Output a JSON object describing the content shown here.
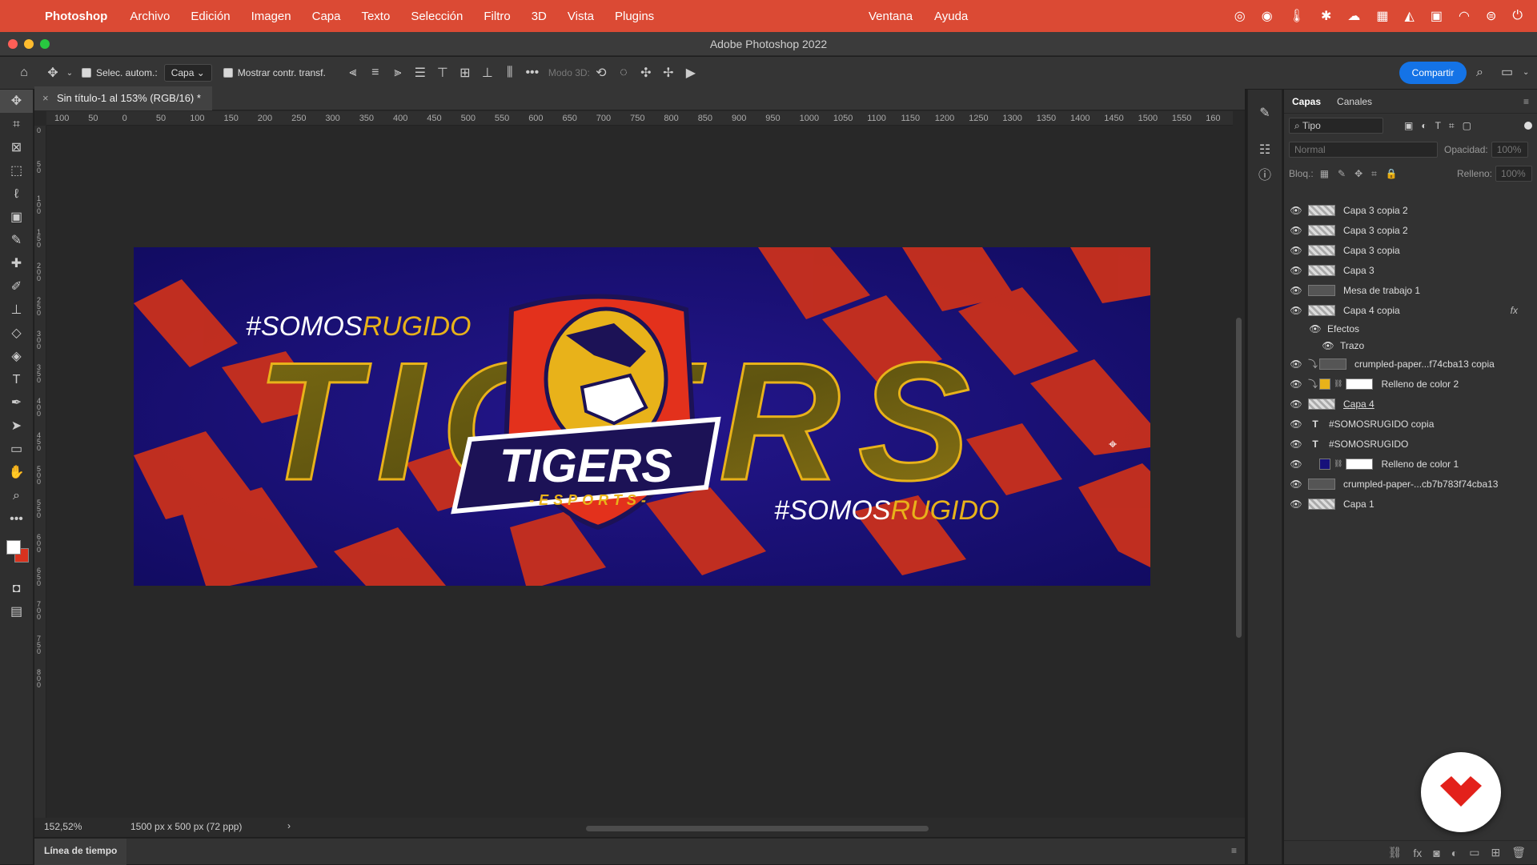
{
  "menubar": {
    "app": "Photoshop",
    "items": [
      "Archivo",
      "Edición",
      "Imagen",
      "Capa",
      "Texto",
      "Selección",
      "Filtro",
      "3D",
      "Vista",
      "Plugins"
    ],
    "ventana": "Ventana",
    "ayuda": "Ayuda"
  },
  "window": {
    "title": "Adobe Photoshop 2022"
  },
  "options": {
    "auto_select": "Selec. autom.:",
    "auto_select_target": "Capa",
    "show_transform": "Mostrar contr. transf.",
    "mode3d": "Modo 3D:",
    "share": "Compartir"
  },
  "document": {
    "tab": "Sin título-1 al 153% (RGB/16) *",
    "zoom": "152,52%",
    "info": "1500 px x 500 px (72 ppp)"
  },
  "ruler": {
    "h": [
      "100",
      "50",
      "0",
      "50",
      "100",
      "150",
      "200",
      "250",
      "300",
      "350",
      "400",
      "450",
      "500",
      "550",
      "600",
      "650",
      "700",
      "750",
      "800",
      "850",
      "900",
      "950",
      "1000",
      "1050",
      "1100",
      "1150",
      "1200",
      "1250",
      "1300",
      "1350",
      "1400",
      "1450",
      "1500",
      "1550",
      "160"
    ],
    "v": [
      "0",
      "50",
      "100",
      "150",
      "200",
      "250",
      "300",
      "350",
      "400",
      "450",
      "500",
      "550",
      "600",
      "650",
      "700",
      "750",
      "800"
    ]
  },
  "artwork": {
    "hashtag_prefix": "#SOMOS",
    "hashtag_suffix": "RUGIDO",
    "big_word": "TIGERS",
    "logo_word": "TIGERS",
    "logo_sub": "-ESPORTS-"
  },
  "timeline": {
    "label": "Línea de tiempo"
  },
  "panel": {
    "tabs": [
      "Capas",
      "Canales"
    ],
    "filter": "Tipo",
    "blend": "Normal",
    "opacity_label": "Opacidad:",
    "opacity": "100%",
    "lock_label": "Bloq.:",
    "fill_label": "Relleno:",
    "fill": "100%"
  },
  "layers": [
    {
      "name": "Capa 3 copia 2",
      "kind": "pixel"
    },
    {
      "name": "Capa 3 copia 2",
      "kind": "pixel"
    },
    {
      "name": "Capa 3 copia",
      "kind": "pixel"
    },
    {
      "name": "Capa 3",
      "kind": "pixel"
    },
    {
      "name": "Mesa de trabajo 1",
      "kind": "smart"
    },
    {
      "name": "Capa 4 copia",
      "kind": "pixel",
      "fx": "fx"
    },
    {
      "name": "Efectos",
      "kind": "effect"
    },
    {
      "name": "Trazo",
      "kind": "effect2"
    },
    {
      "name": "crumpled-paper...f74cba13 copia",
      "kind": "smart-clip"
    },
    {
      "name": "Relleno de color 2",
      "kind": "fill-yellow"
    },
    {
      "name": "Capa 4",
      "kind": "pixel"
    },
    {
      "name": "#SOMOSRUGIDO copia",
      "kind": "text"
    },
    {
      "name": "#SOMOSRUGIDO",
      "kind": "text"
    },
    {
      "name": "Relleno de color 1",
      "kind": "fill-navy"
    },
    {
      "name": "crumpled-paper-...cb7b783f74cba13",
      "kind": "smart"
    },
    {
      "name": "Capa 1",
      "kind": "pixel"
    }
  ],
  "colors": {
    "menubar": "#db4a34",
    "navy": "#16107a",
    "red": "#d8321e",
    "gold": "#e8b21a",
    "accent": "#1473e6"
  }
}
